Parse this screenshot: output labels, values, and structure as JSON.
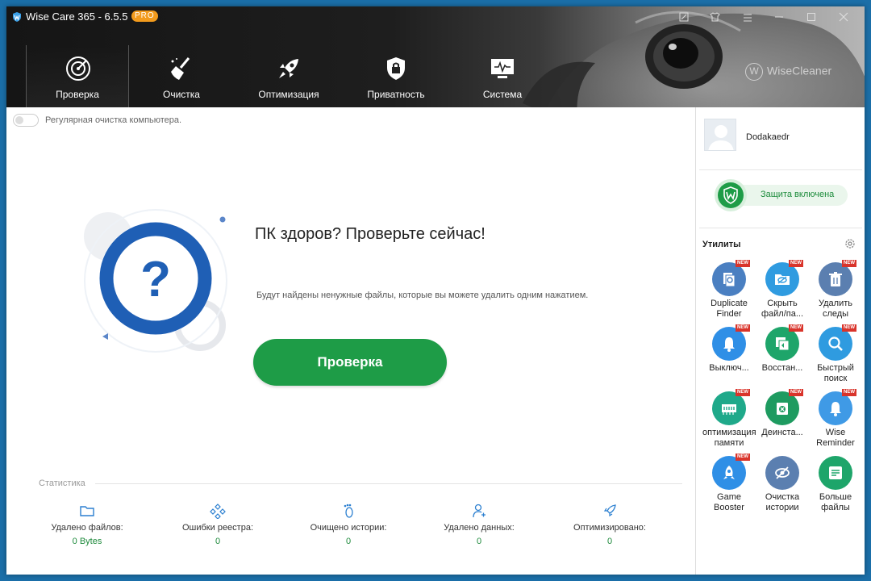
{
  "window": {
    "title": "Wise Care 365 - 6.5.5",
    "badge": "PRO",
    "brand": "WiseCleaner"
  },
  "nav": [
    {
      "label": "Проверка",
      "icon": "radar-icon",
      "active": true
    },
    {
      "label": "Очистка",
      "icon": "broom-icon"
    },
    {
      "label": "Оптимизация",
      "icon": "rocket-icon"
    },
    {
      "label": "Приватность",
      "icon": "lock-shield-icon"
    },
    {
      "label": "Система",
      "icon": "monitor-icon"
    }
  ],
  "main": {
    "toggle_label": "Регулярная очистка компьютера.",
    "headline": "ПК здоров? Проверьте сейчас!",
    "subline": "Будут найдены ненужные файлы, которые вы можете удалить одним нажатием.",
    "scan_button": "Проверка"
  },
  "stats": {
    "title": "Статистика",
    "items": [
      {
        "label": "Удалено файлов:",
        "value": "0 Bytes",
        "icon": "folder-icon"
      },
      {
        "label": "Ошибки реестра:",
        "value": "0",
        "icon": "registry-icon"
      },
      {
        "label": "Очищено истории:",
        "value": "0",
        "icon": "footprint-icon"
      },
      {
        "label": "Удалено данных:",
        "value": "0",
        "icon": "user-data-icon"
      },
      {
        "label": "Оптимизировано:",
        "value": "0",
        "icon": "rocket-icon"
      }
    ]
  },
  "sidebar": {
    "username": "Dodakaedr",
    "protection": "Защита включена",
    "utils_title": "Утилиты",
    "new_badge": "NEW",
    "utils": [
      {
        "label": "Duplicate Finder",
        "new": true,
        "color": "#4a7fc1",
        "icon": "duplicate-finder-icon"
      },
      {
        "label": "Скрыть файл/па...",
        "new": true,
        "color": "#2f9be0",
        "icon": "hide-folder-icon"
      },
      {
        "label": "Удалить следы",
        "new": true,
        "color": "#5b7fb0",
        "icon": "trash-icon"
      },
      {
        "label": "Выключ...",
        "new": true,
        "color": "#2f8fe6",
        "icon": "bell-icon"
      },
      {
        "label": "Восстан...",
        "new": true,
        "color": "#1ea56a",
        "icon": "restore-icon"
      },
      {
        "label": "Быстрый поиск",
        "new": true,
        "color": "#2f9be0",
        "icon": "search-icon"
      },
      {
        "label": "оптимизация памяти",
        "new": true,
        "color": "#1fa98a",
        "icon": "memory-icon"
      },
      {
        "label": "Деинста...",
        "new": true,
        "color": "#1e9b60",
        "icon": "uninstall-icon"
      },
      {
        "label": "Wise Reminder",
        "new": true,
        "color": "#3f9ae6",
        "icon": "bell-icon"
      },
      {
        "label": "Game Booster",
        "new": true,
        "color": "#2f8fe6",
        "icon": "game-booster-icon"
      },
      {
        "label": "Очистка истории",
        "new": false,
        "color": "#5b7fb0",
        "icon": "eye-off-icon"
      },
      {
        "label": "Больше файлы",
        "new": false,
        "color": "#1ea56a",
        "icon": "big-files-icon"
      }
    ]
  }
}
